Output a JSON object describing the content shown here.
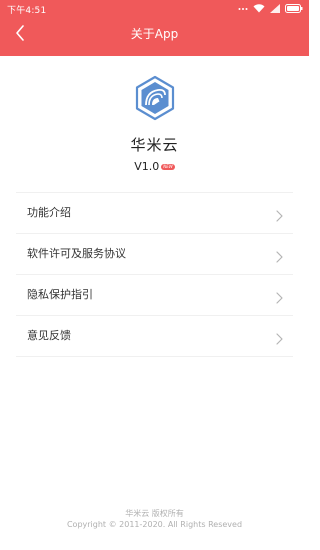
{
  "status_bar": {
    "time": "下午4:51",
    "icons": [
      "dots-icon",
      "wifi-icon",
      "signal-icon",
      "battery-icon"
    ]
  },
  "header": {
    "title": "关于App",
    "back_icon": "chevron-left-icon",
    "background_color": "#f0595a"
  },
  "app": {
    "name": "华米云",
    "version": "V1.0",
    "badge": "NEW",
    "logo_icon": "hexagon-cloud-logo"
  },
  "menu": {
    "items": [
      {
        "label": "功能介绍"
      },
      {
        "label": "软件许可及服务协议"
      },
      {
        "label": "隐私保护指引"
      },
      {
        "label": "意见反馈"
      }
    ],
    "chevron_icon": "chevron-right-icon"
  },
  "footer": {
    "line1": "华米云 版权所有",
    "line2": "Copyright © 2011-2020. All Rights Reseved"
  }
}
